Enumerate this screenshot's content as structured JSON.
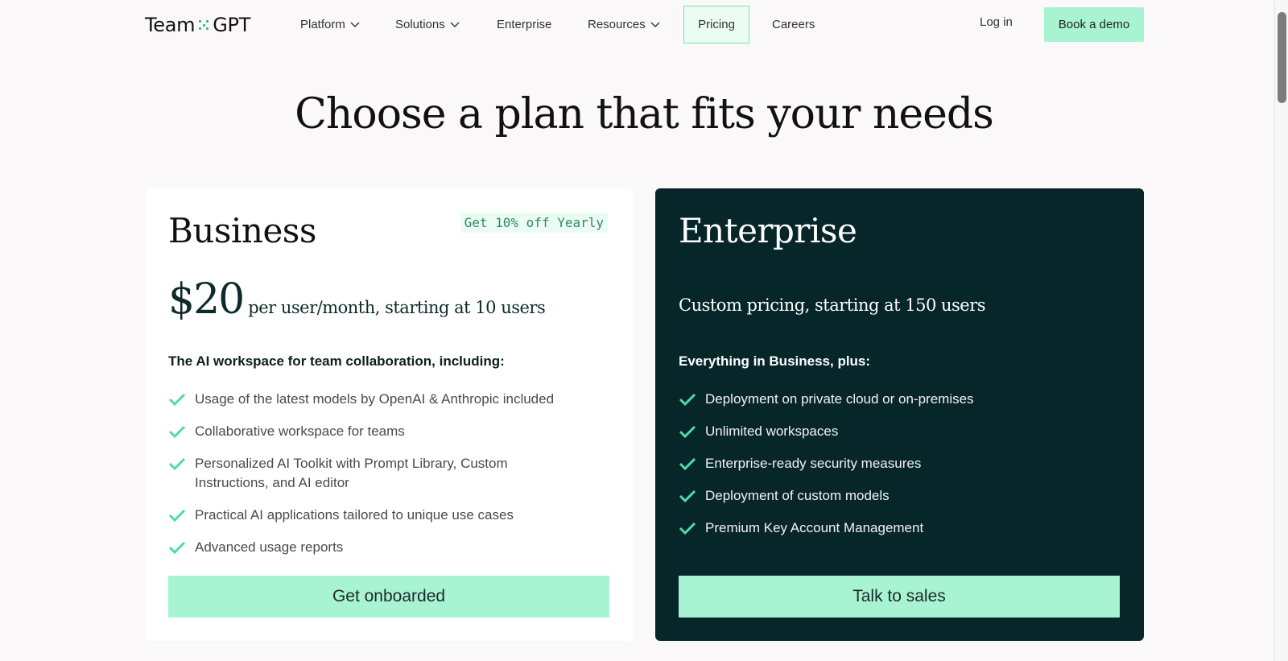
{
  "header": {
    "logo": {
      "left": "Team",
      "right": "GPT"
    },
    "nav": [
      {
        "label": "Platform",
        "has_dropdown": true
      },
      {
        "label": "Solutions",
        "has_dropdown": true
      },
      {
        "label": "Enterprise",
        "has_dropdown": false
      },
      {
        "label": "Resources",
        "has_dropdown": true
      },
      {
        "label": "Pricing",
        "has_dropdown": false,
        "active": true
      },
      {
        "label": "Careers",
        "has_dropdown": false
      }
    ],
    "login_label": "Log in",
    "book_demo_label": "Book a demo"
  },
  "main": {
    "title": "Choose a plan that fits your needs",
    "plans": [
      {
        "name": "Business",
        "badge": "Get 10% off Yearly",
        "price": "$20",
        "price_desc": "per user/month, starting at 10 users",
        "features_heading": "The AI workspace for team collaboration, including:",
        "features": [
          "Usage of the latest models by OpenAI & Anthropic included",
          "Collaborative workspace for teams",
          "Personalized AI Toolkit with Prompt Library, Custom Instructions, and AI editor",
          "Practical AI applications tailored to unique use cases",
          "Advanced usage reports"
        ],
        "cta_label": "Get onboarded"
      },
      {
        "name": "Enterprise",
        "price_desc": "Custom pricing, starting at 150 users",
        "features_heading": "Everything in Business, plus:",
        "features": [
          "Deployment on private cloud or on-premises",
          "Unlimited workspaces",
          "Enterprise-ready security measures",
          "Deployment of custom models",
          "Premium Key Account Management"
        ],
        "cta_label": "Talk to sales"
      }
    ]
  },
  "colors": {
    "accent": "#a8f3d2",
    "check": "#4fdca5",
    "enterprise_bg": "#06262a",
    "page_bg": "#faf8f8"
  },
  "icons": {
    "dropdown": "chevron-down-icon",
    "feature": "check-icon",
    "logo_separator": "dots-icon"
  }
}
